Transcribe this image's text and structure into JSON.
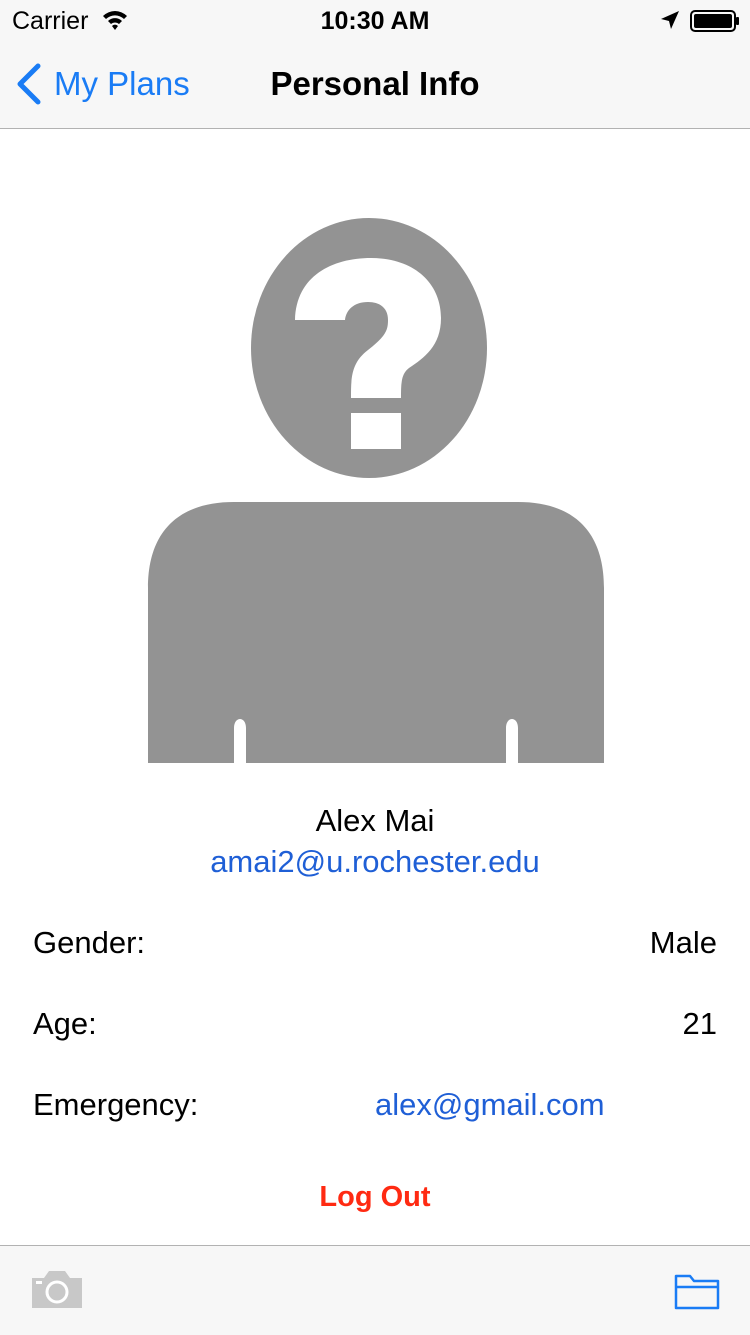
{
  "status_bar": {
    "carrier": "Carrier",
    "time": "10:30 AM",
    "icons": [
      "wifi-icon",
      "location-arrow-icon",
      "battery-icon"
    ]
  },
  "nav": {
    "back_label": "My Plans",
    "title": "Personal Info",
    "accent_color": "#1a7cf5"
  },
  "profile": {
    "avatar": "unknown-person-placeholder",
    "name": "Alex Mai",
    "email": "amai2@u.rochester.edu"
  },
  "details": {
    "gender_label": "Gender:",
    "gender_value": "Male",
    "age_label": "Age:",
    "age_value": "21",
    "emergency_label": "Emergency:",
    "emergency_value": "alex@gmail.com"
  },
  "actions": {
    "logout_label": "Log Out",
    "logout_color": "#ff2a12"
  },
  "toolbar": {
    "left_icon": "camera-icon",
    "left_state": "disabled",
    "right_icon": "folder-icon"
  }
}
